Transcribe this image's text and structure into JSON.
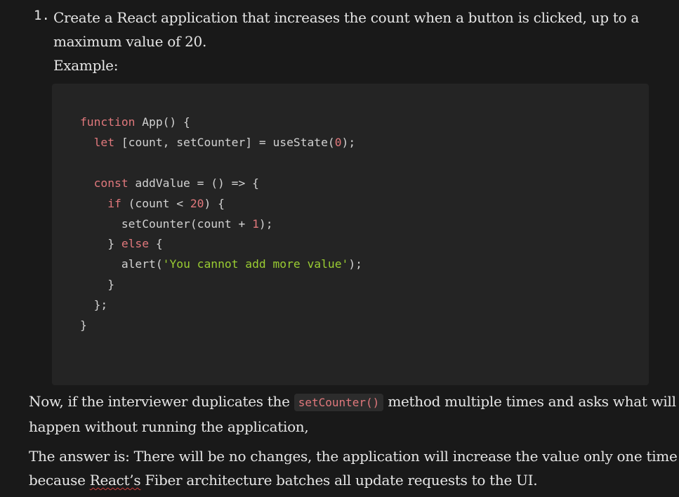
{
  "list": {
    "number": "1.",
    "line1": "Create a React application that increases the count when a button is clicked, up to a",
    "line2": "maximum value of 20.",
    "example_label": "Example:"
  },
  "code": {
    "l1_kw": "function",
    "l1_rest": " App() {",
    "l2_kw": "let",
    "l2_rest": " [count, setCounter] = useState(",
    "l2_num": "0",
    "l2_end": ");",
    "l4_kw": "const",
    "l4_rest": " addValue = () => {",
    "l5_kw": "if",
    "l5_rest": " (count < ",
    "l5_num": "20",
    "l5_end": ") {",
    "l6_rest": "setCounter(count + ",
    "l6_num": "1",
    "l6_end": ");",
    "l7_open": "} ",
    "l7_kw": "else",
    "l7_end": " {",
    "l8_rest": "alert(",
    "l8_str": "'You cannot add more value'",
    "l8_end": ");",
    "l9": "}",
    "l10": "};",
    "l11": "}"
  },
  "para1": {
    "before": "Now, if the interviewer duplicates the ",
    "code": "setCounter()",
    "after": " method multiple times and asks what will",
    "line2": "happen without running the application,"
  },
  "para2": {
    "line1": "The answer is: There will be no changes, the application will increase the value only one time",
    "line2_before": "because ",
    "line2_spell": "React’s",
    "line2_after": " Fiber architecture batches all update requests to the UI."
  }
}
